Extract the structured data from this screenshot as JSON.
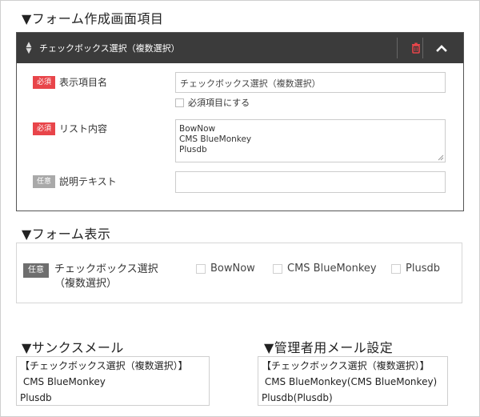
{
  "sections": {
    "builder_title": "▼フォーム作成画面項目",
    "preview_title": "▼フォーム表示",
    "thanks_title": "▼サンクスメール",
    "admin_title": "▼管理者用メール設定"
  },
  "builder": {
    "header_title": "チェックボックス選択（複数選択）",
    "icons": {
      "drag": "sort-icon",
      "delete": "trash-icon",
      "collapse": "chevron-up-icon"
    },
    "colors": {
      "header_bg": "#3b3b3b",
      "delete": "#e8454a"
    },
    "rows": {
      "display_name": {
        "badge": "必須",
        "label": "表示項目名",
        "value": "チェックボックス選択（複数選択）",
        "required_checkbox_label": "必須項目にする"
      },
      "list": {
        "badge": "必須",
        "label": "リスト内容",
        "lines": [
          "BowNow",
          "CMS BlueMonkey",
          "Plusdb"
        ]
      },
      "description": {
        "badge": "任意",
        "label": "説明テキスト",
        "value": ""
      }
    }
  },
  "preview": {
    "badge": "任意",
    "label_line1": "チェックボックス選択",
    "label_line2": "（複数選択）",
    "options": [
      "BowNow",
      "CMS BlueMonkey",
      "Plusdb"
    ]
  },
  "thanks_mail": {
    "lines": [
      "【チェックボックス選択（複数選択）】",
      " CMS BlueMonkey",
      "Plusdb"
    ]
  },
  "admin_mail": {
    "lines": [
      "【チェックボックス選択（複数選択）】",
      " CMS BlueMonkey(CMS BlueMonkey)",
      "Plusdb(Plusdb)"
    ]
  }
}
